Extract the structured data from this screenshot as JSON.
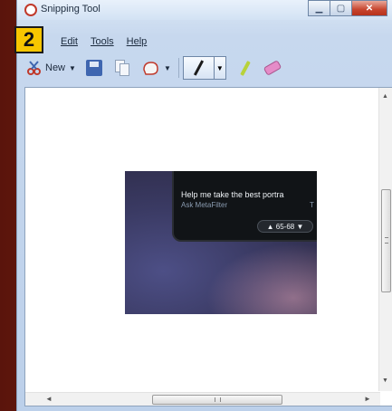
{
  "window": {
    "title": "Snipping Tool"
  },
  "callout_badge": "2",
  "menubar": {
    "items": [
      {
        "label": "Edit"
      },
      {
        "label": "Tools"
      },
      {
        "label": "Help"
      }
    ]
  },
  "toolbar": {
    "new_label": "New",
    "icons": [
      "new-snip-icon",
      "save-icon",
      "copy-icon",
      "send-snip-icon",
      "pen-icon",
      "highlighter-icon",
      "eraser-icon"
    ]
  },
  "snip": {
    "headline": "Help me take the best portra",
    "source": "Ask MetaFilter",
    "source_suffix": "T",
    "pill_text": "▲ 65-68 ▼"
  },
  "colors": {
    "badge": "#f7c600",
    "close_button": "#c7452e",
    "desktop": "#6b1a10"
  }
}
